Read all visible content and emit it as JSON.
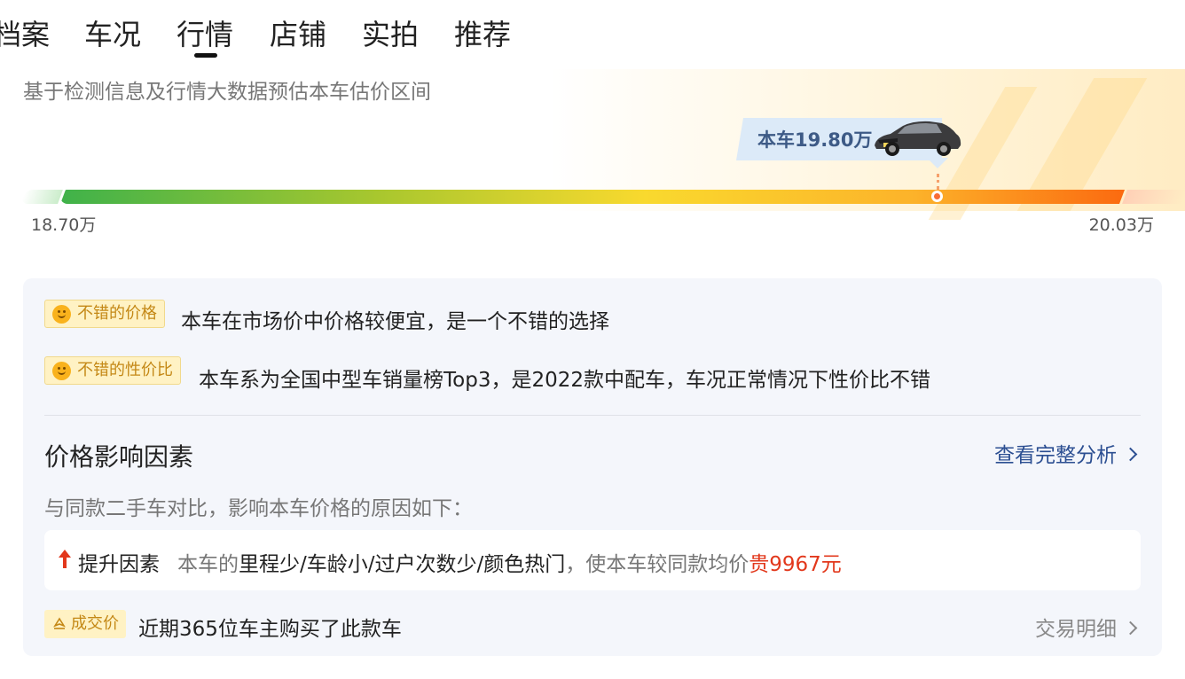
{
  "tabs": [
    {
      "label": "档案"
    },
    {
      "label": "车况"
    },
    {
      "label": "行情",
      "active": true
    },
    {
      "label": "店铺"
    },
    {
      "label": "实拍"
    },
    {
      "label": "推荐"
    }
  ],
  "hero": {
    "subtitle": "基于检测信息及行情大数据预估本车估价区间",
    "current_price_tag": "本车19.80万",
    "range_min": "18.70万",
    "range_max": "20.03万",
    "current_price_value": 19.8,
    "range_min_value": 18.7,
    "range_max_value": 20.03,
    "car_image_icon": "car-icon"
  },
  "highlights": [
    {
      "badge": "不错的价格",
      "text": "本车在市场价中价格较便宜，是一个不错的选择",
      "icon": "smile-icon"
    },
    {
      "badge": "不错的性价比",
      "text": "本车系为全国中型车销量榜Top3，是2022款中配车，车况正常情况下性价比不错",
      "icon": "smile-icon"
    }
  ],
  "factors": {
    "title": "价格影响因素",
    "link": "查看完整分析",
    "description": "与同款二手车对比，影响本车价格的原因如下：",
    "up_label": "提升因素",
    "up_prefix": "本车的",
    "up_items": "里程少/车龄小/过户次数少/颜色热门",
    "up_mid": "，使本车较同款均价",
    "up_amount": "贵9967元"
  },
  "deal": {
    "badge": "成交价",
    "text": "近期365位车主购买了此款车",
    "link": "交易明细"
  },
  "colors": {
    "accent_blue": "#2c4f92",
    "price_red": "#e2381c",
    "badge_bg": "#fff2c4",
    "badge_text": "#c48816",
    "gradient": [
      "#3fb24a",
      "#f9d92e",
      "#fb6a10"
    ]
  }
}
